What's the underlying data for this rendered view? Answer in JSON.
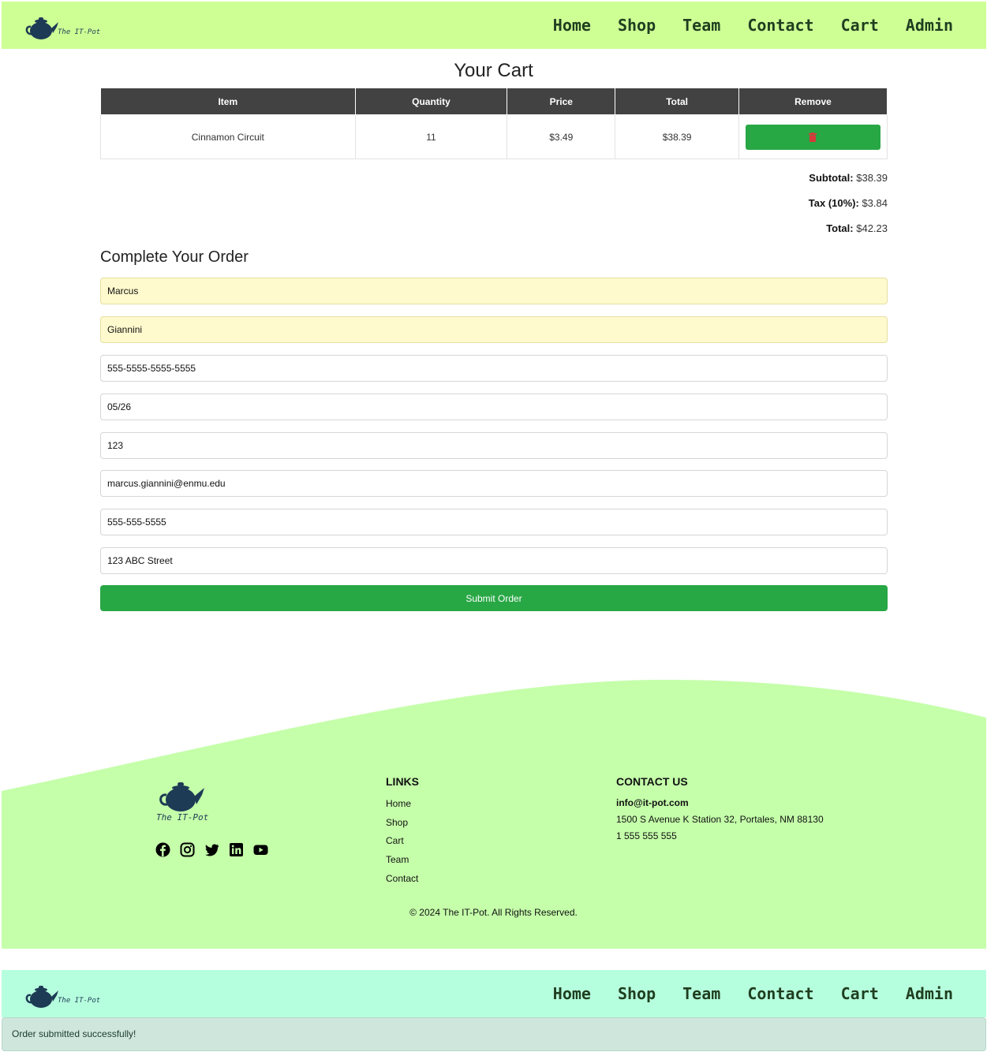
{
  "header": {
    "brand": "The IT-Pot",
    "nav": [
      "Home",
      "Shop",
      "Team",
      "Contact",
      "Cart",
      "Admin"
    ],
    "background": "#ceff95"
  },
  "header_secondary": {
    "brand": "The IT-Pot",
    "nav": [
      "Home",
      "Shop",
      "Team",
      "Contact",
      "Cart",
      "Admin"
    ],
    "background": "#b6ffde"
  },
  "cart": {
    "title": "Your Cart",
    "columns": [
      "Item",
      "Quantity",
      "Price",
      "Total",
      "Remove"
    ],
    "rows": [
      {
        "item": "Cinnamon Circuit",
        "quantity": "11",
        "price": "$3.49",
        "total": "$38.39",
        "remove_icon": "trash-icon"
      }
    ],
    "subtotal_label": "Subtotal:",
    "subtotal": "$38.39",
    "tax_label": "Tax (10%):",
    "tax": "$3.84",
    "total_label": "Total:",
    "total": "$42.23"
  },
  "order_form": {
    "title": "Complete Your Order",
    "first_name": "Marcus",
    "last_name": "Giannini",
    "card_number": "555-5555-5555-5555",
    "expiry": "05/26",
    "cvv": "123",
    "email": "marcus.giannini@enmu.edu",
    "phone": "555-555-5555",
    "address": "123 ABC Street",
    "submit_label": "Submit Order",
    "accent": "#28a745"
  },
  "footer": {
    "brand": "The IT-Pot",
    "socials": [
      "facebook-icon",
      "instagram-icon",
      "twitter-icon",
      "linkedin-icon",
      "youtube-icon"
    ],
    "links_title": "LINKS",
    "links": [
      "Home",
      "Shop",
      "Cart",
      "Team",
      "Contact"
    ],
    "contact_title": "CONTACT US",
    "email": "info@it-pot.com",
    "address": "1500 S Avenue K Station 32, Portales, NM 88130",
    "phone": "1 555 555 555",
    "copyright": "© 2024 The IT-Pot. All Rights Reserved.",
    "background": "#c5ffaa"
  },
  "alert": {
    "message": "Order submitted successfully!"
  }
}
